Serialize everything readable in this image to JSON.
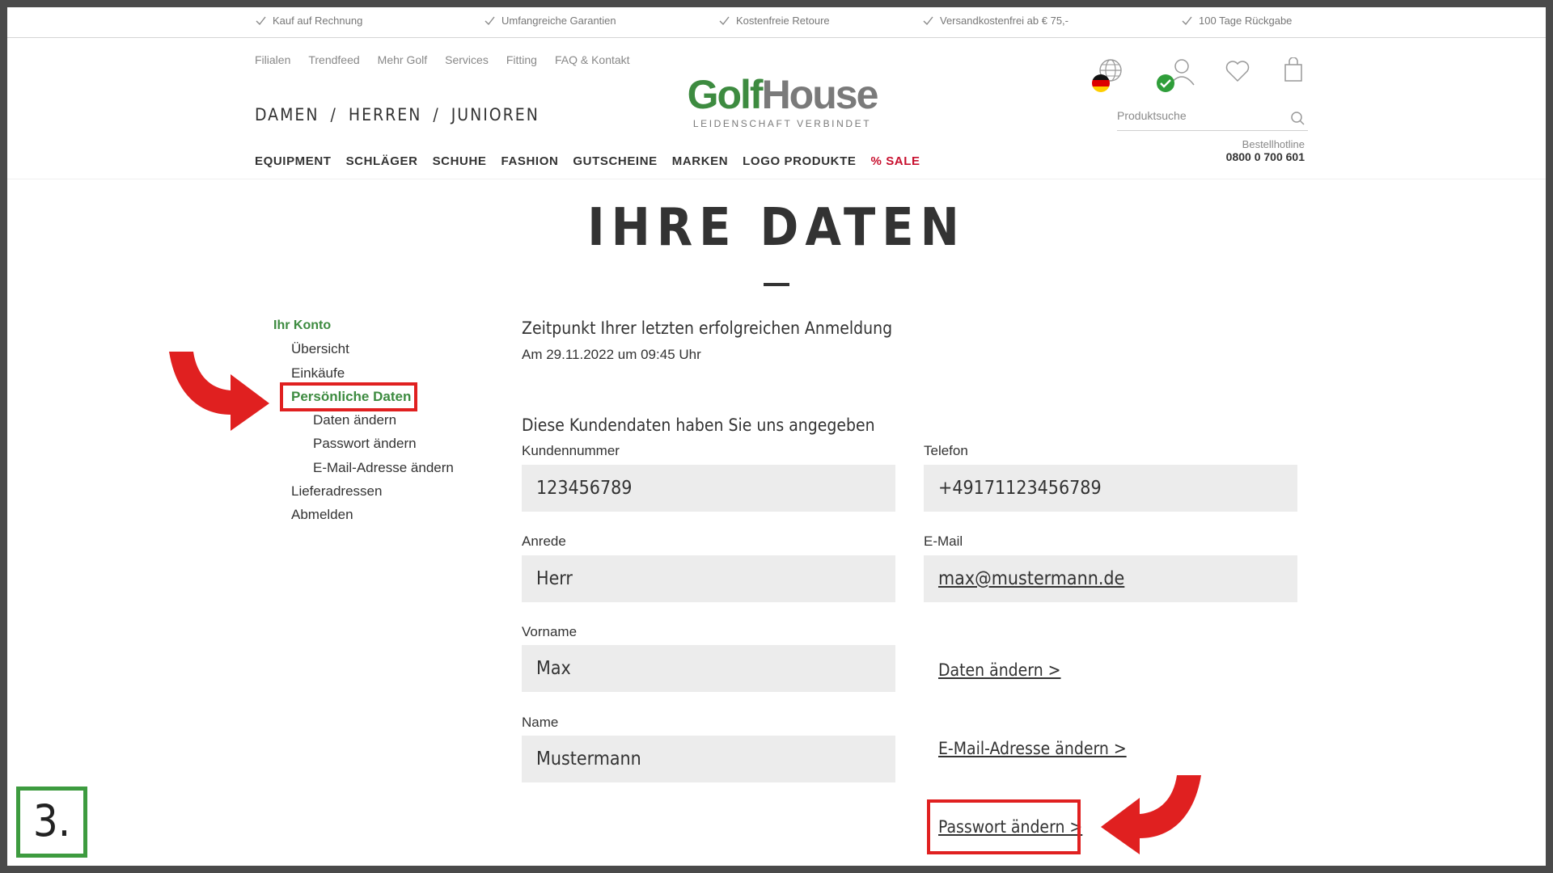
{
  "usp_bar": [
    "Kauf auf Rechnung",
    "Umfangreiche Garantien",
    "Kostenfreie Retoure",
    "Versandkostenfrei ab € 75,-",
    "100 Tage Rückgabe"
  ],
  "top_links": [
    "Filialen",
    "Trendfeed",
    "Mehr Golf",
    "Services",
    "Fitting",
    "FAQ & Kontakt"
  ],
  "gender_nav": [
    "DAMEN",
    "/",
    "HERREN",
    "/",
    "JUNIOREN"
  ],
  "main_nav": [
    "EQUIPMENT",
    "SCHLÄGER",
    "SCHUHE",
    "FASHION",
    "GUTSCHEINE",
    "MARKEN",
    "LOGO PRODUKTE",
    "% SALE"
  ],
  "logo": {
    "word1": "Golf",
    "word2": "House",
    "tagline": "LEIDENSCHAFT VERBINDET"
  },
  "search": {
    "placeholder": "Produktsuche"
  },
  "hotline": {
    "label": "Bestellhotline",
    "number": "0800 0 700 601"
  },
  "page_title": "IHRE DATEN",
  "sidebar": {
    "head": "Ihr Konto",
    "items": [
      "Übersicht",
      "Einkäufe",
      "Persönliche Daten",
      "Daten ändern",
      "Passwort ändern",
      "E-Mail-Adresse ändern",
      "Lieferadressen",
      "Abmelden"
    ]
  },
  "last_login": {
    "heading": "Zeitpunkt Ihrer letzten erfolgreichen Anmeldung",
    "value": "Am 29.11.2022 um 09:45 Uhr"
  },
  "customer": {
    "heading": "Diese Kundendaten haben Sie uns angegeben",
    "fields": {
      "kundennummer": {
        "label": "Kundennummer",
        "value": "123456789"
      },
      "telefon": {
        "label": "Telefon",
        "value": "+49171123456789"
      },
      "anrede": {
        "label": "Anrede",
        "value": "Herr"
      },
      "email": {
        "label": "E-Mail",
        "value": "max@mustermann.de"
      },
      "vorname": {
        "label": "Vorname",
        "value": "Max"
      },
      "name": {
        "label": "Name",
        "value": "Mustermann"
      }
    },
    "links": {
      "edit_data": "Daten ändern >",
      "edit_email": "E-Mail-Adresse ändern >",
      "edit_password": "Passwort ändern >"
    }
  },
  "step_badge": "3.",
  "colors": {
    "brand_green": "#3d8b40",
    "sale_red": "#c8102e",
    "annotation_red": "#e02020",
    "badge_green": "#3d9b3f",
    "field_bg": "#ececec"
  },
  "icons": [
    "check-icon",
    "globe-icon",
    "germany-flag-icon",
    "account-icon",
    "check-badge-icon",
    "heart-icon",
    "bag-icon",
    "search-icon"
  ]
}
